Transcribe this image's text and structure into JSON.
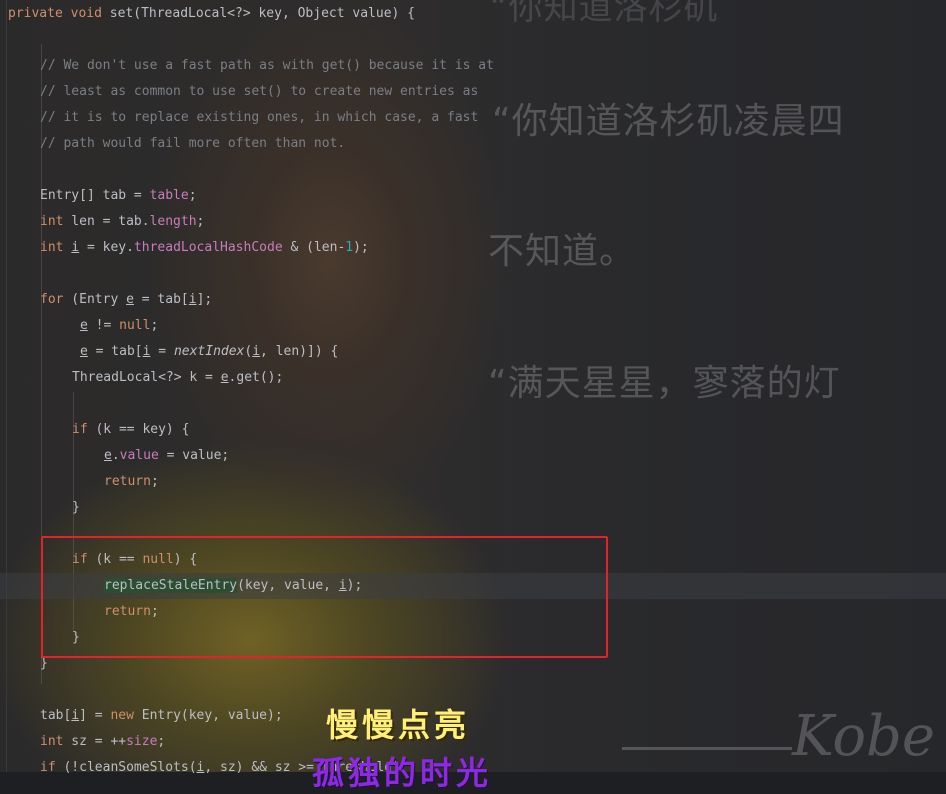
{
  "wallpaper": {
    "text_top": "“你知道洛杉矶",
    "text_1": "“你知道洛杉矶凌晨四",
    "text_2": "不知道。",
    "text_3": "“满天星星，寥落的灯",
    "signature": "Kobe"
  },
  "subtitle": {
    "line1": "慢慢点亮",
    "line2": "孤独的时光"
  },
  "code": {
    "sig_private": "private",
    "sig_void": "void",
    "sig_rest": " set(ThreadLocal<?> key, Object value) {",
    "c1": "// We don't use a fast path as with get() because it is at",
    "c2": "// least as common to use set() to create new entries as",
    "c3": "// it is to replace existing ones, in which case, a fast",
    "c4": "// path would fail more often than not.",
    "l_tab_a": "Entry[] tab = ",
    "l_tab_b": "table",
    "l_tab_c": ";",
    "l_len_kw": "int",
    "l_len_a": " len = tab.",
    "l_len_b": "length",
    "l_len_c": ";",
    "l_i_kw": "int",
    "l_i_sp": " ",
    "l_i_var": "i",
    "l_i_a": " = key.",
    "l_i_b": "threadLocalHashCode",
    "l_i_c": " & (len-",
    "l_i_d": "1",
    "l_i_e": ");",
    "for_kw": "for",
    "for_a": " (Entry ",
    "for_e": "e",
    "for_b": " = tab[",
    "for_i": "i",
    "for_c": "];",
    "cond_e": "e",
    "cond_a": " != ",
    "cond_null": "null",
    "cond_b": ";",
    "upd_e": "e",
    "upd_a": " = tab[",
    "upd_i": "i",
    "upd_b": " = ",
    "upd_next": "nextIndex",
    "upd_c": "(",
    "upd_i2": "i",
    "upd_d": ", len)]) {",
    "tl_a": "ThreadLocal<?> k = ",
    "tl_e": "e",
    "tl_b": ".get();",
    "if1_kw": "if",
    "if1_a": " (k == key) {",
    "ev_e": "e",
    "ev_a": ".",
    "ev_b": "value",
    "ev_c": " = value;",
    "ret1": "return",
    "ret1_s": ";",
    "brace1": "}",
    "if2_kw": "if",
    "if2_a": " (k == ",
    "if2_null": "null",
    "if2_b": ") {",
    "rse_m": "replaceStaleEntry",
    "rse_a": "(key, value, ",
    "rse_i": "i",
    "rse_b": ");",
    "ret2": "return",
    "ret2_s": ";",
    "brace2": "}",
    "brace3": "}",
    "tabi_a": "tab[",
    "tabi_i": "i",
    "tabi_b": "] = ",
    "tabi_new": "new",
    "tabi_c": " Entry(key, value);",
    "sz_kw": "int",
    "sz_a": " sz = ++",
    "sz_b": "size",
    "sz_c": ";",
    "cl_kw": "if",
    "cl_a": " (!cleanSomeSlots(",
    "cl_i": "i",
    "cl_b": ", sz) && sz >= threshold)"
  },
  "colors": {
    "keyword": "#cf8e6d",
    "comment": "#7a7e85",
    "field": "#c77dbb",
    "method": "#56a8f5",
    "number": "#2aacb8",
    "highlight_box": "#e2232c"
  }
}
